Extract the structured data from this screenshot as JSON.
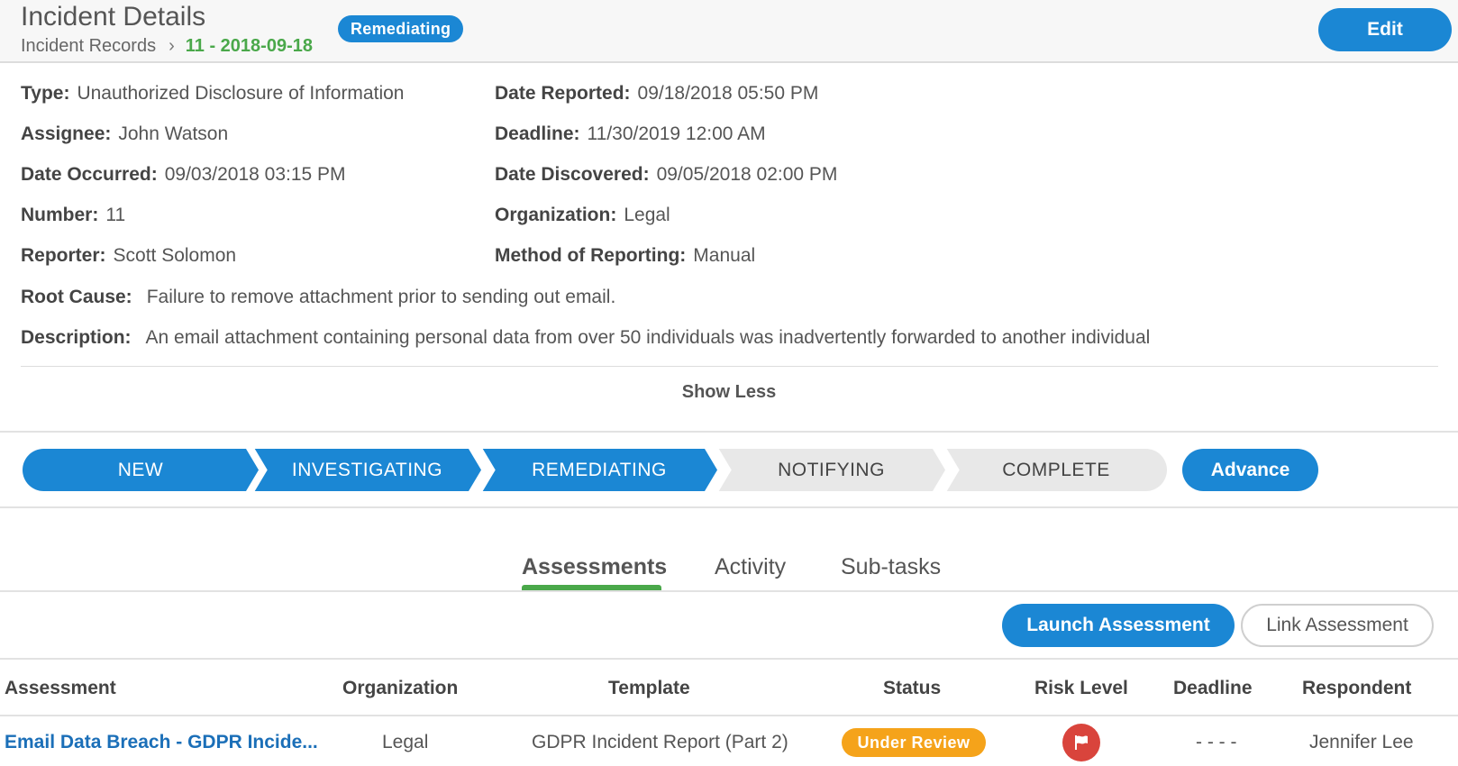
{
  "header": {
    "title": "Incident Details",
    "status": "Remediating",
    "breadcrumb_parent": "Incident Records",
    "breadcrumb_current": "11 - 2018-09-18",
    "edit_label": "Edit"
  },
  "details": {
    "type": {
      "label": "Type:",
      "value": "Unauthorized Disclosure of Information"
    },
    "date_reported": {
      "label": "Date Reported:",
      "value": "09/18/2018 05:50 PM"
    },
    "assignee": {
      "label": "Assignee:",
      "value": "John Watson"
    },
    "deadline": {
      "label": "Deadline:",
      "value": "11/30/2019 12:00 AM"
    },
    "date_occurred": {
      "label": "Date Occurred:",
      "value": "09/03/2018 03:15 PM"
    },
    "date_discovered": {
      "label": "Date Discovered:",
      "value": "09/05/2018 02:00 PM"
    },
    "number": {
      "label": "Number:",
      "value": "11"
    },
    "organization": {
      "label": "Organization:",
      "value": "Legal"
    },
    "reporter": {
      "label": "Reporter:",
      "value": "Scott Solomon"
    },
    "method": {
      "label": "Method of Reporting:",
      "value": "Manual"
    },
    "root_cause": {
      "label": "Root Cause:",
      "value": "Failure to remove attachment prior to sending out email."
    },
    "description": {
      "label": "Description:",
      "value": "An email attachment containing personal data from over 50 individuals was inadvertently forwarded to another individual"
    },
    "show_less": "Show Less"
  },
  "stepper": {
    "steps": [
      {
        "label": "NEW",
        "active": true
      },
      {
        "label": "INVESTIGATING",
        "active": true
      },
      {
        "label": "REMEDIATING",
        "active": true
      },
      {
        "label": "NOTIFYING",
        "active": false
      },
      {
        "label": "COMPLETE",
        "active": false
      }
    ],
    "advance_label": "Advance"
  },
  "tabs": [
    {
      "label": "Assessments",
      "active": true
    },
    {
      "label": "Activity",
      "active": false
    },
    {
      "label": "Sub-tasks",
      "active": false
    }
  ],
  "actions": {
    "launch_label": "Launch Assessment",
    "link_label": "Link Assessment"
  },
  "table": {
    "columns": [
      "Assessment",
      "Organization",
      "Template",
      "Status",
      "Risk Level",
      "Deadline",
      "Respondent"
    ],
    "rows": [
      {
        "assessment": "Email Data Breach - GDPR Incide...",
        "organization": "Legal",
        "template": "GDPR Incident Report (Part 2)",
        "status": "Under Review",
        "risk_icon": "flag-icon",
        "deadline": "- - - -",
        "respondent": "Jennifer Lee"
      }
    ]
  },
  "colors": {
    "primary": "#1b87d4",
    "success": "#4aa84a",
    "warning": "#f5a31a",
    "danger": "#d9443c",
    "inactive_step": "#e8e8e8"
  }
}
